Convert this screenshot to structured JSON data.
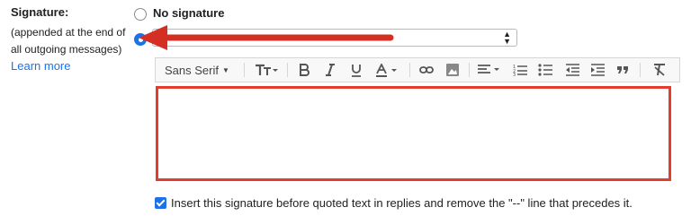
{
  "signature": {
    "label": "Signature:",
    "description": "(appended at the end of all outgoing messages)",
    "learn_more": "Learn more"
  },
  "options": {
    "no_signature": "No signature",
    "selected": "custom",
    "selected_signature_text": " "
  },
  "toolbar": {
    "font": "Sans Serif",
    "icons": [
      "text-size-icon",
      "bold-icon",
      "italic-icon",
      "underline-icon",
      "text-color-icon",
      "link-icon",
      "image-icon",
      "align-icon",
      "numbered-list-icon",
      "bulleted-list-icon",
      "indent-less-icon",
      "indent-more-icon",
      "quote-icon",
      "remove-formatting-icon"
    ]
  },
  "editor": {
    "content": ""
  },
  "insert_before_quoted": {
    "checked": true,
    "label": "Insert this signature before quoted text in replies and remove the \"--\" line that precedes it."
  },
  "colors": {
    "accent": "#1a73e8",
    "annotation_red": "#e43d30"
  }
}
